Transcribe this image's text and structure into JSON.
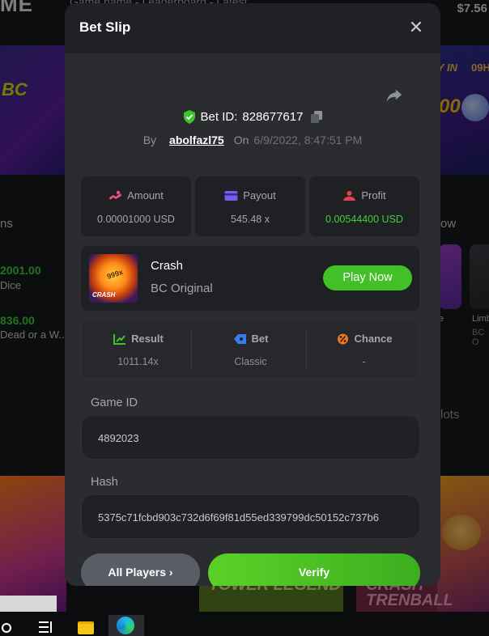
{
  "background": {
    "logo": "ME",
    "top_note": "Game name - Leaderboard - Latest",
    "balance": "$7.56",
    "banner_left_text": "BC",
    "banner_right_a": "Y IN",
    "banner_right_b": "09H",
    "banner_right_coin": "00",
    "section_left": "ns",
    "amount_1": "2001.00",
    "game_1": "Dice",
    "amount_2": "836.00",
    "game_2": "Dead or a W...",
    "section_right": "ow",
    "tile_label_1": "e",
    "tile_label_2": "Limb",
    "tile_label_3": "BC O",
    "slots_label": "lots",
    "promo_1": "TOWER LEGEND",
    "promo_2": "CRASH TRENBALL"
  },
  "modal": {
    "title": "Bet Slip",
    "close_icon": "close-icon",
    "bet_id_label": "Bet ID:",
    "bet_id": "828677617",
    "by_label": "By",
    "username": "abolfazl75",
    "on_label": "On",
    "date": "6/9/2022, 8:47:51 PM",
    "stats": {
      "amount_label": "Amount",
      "amount_value": "0.00001000 USD",
      "payout_label": "Payout",
      "payout_value": "545.48 x",
      "profit_label": "Profit",
      "profit_value": "0.00544400 USD"
    },
    "game": {
      "name": "Crash",
      "subtitle": "BC Original",
      "thumb_multiplier": "999x",
      "thumb_label": "CRASH",
      "play_label": "Play Now"
    },
    "result": {
      "result_label": "Result",
      "result_value": "1011.14x",
      "bet_label": "Bet",
      "bet_value": "Classic",
      "chance_label": "Chance",
      "chance_value": "-"
    },
    "game_id_label": "Game ID",
    "game_id_value": "4892023",
    "hash_label": "Hash",
    "hash_value": "5375c71fcbd903c732d6f69f81d55ed339799dc50152c737b6",
    "all_players_label": "All Players",
    "verify_label": "Verify"
  },
  "colors": {
    "accent_green": "#43c028",
    "profit_green": "#3fd13a",
    "modal_bg": "#1f2124",
    "panel_bg": "#2a2c2f"
  }
}
